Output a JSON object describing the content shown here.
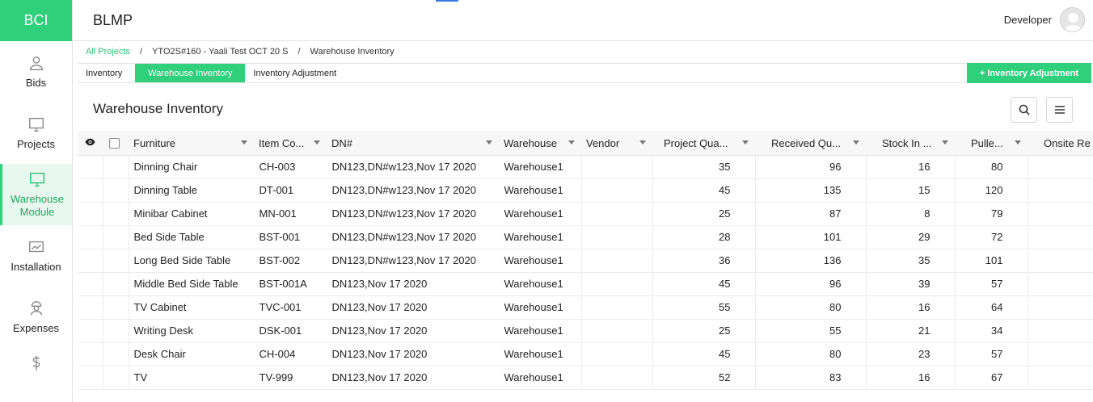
{
  "app": {
    "logo": "BCI",
    "title": "BLMP",
    "user": "Developer"
  },
  "sidebar": {
    "items": [
      {
        "label": "Bids",
        "icon": "person-icon"
      },
      {
        "label": "Projects",
        "icon": "monitor-icon"
      },
      {
        "label": "Warehouse\nModule",
        "icon": "warehouse-icon",
        "active": true
      },
      {
        "label": "Installation",
        "icon": "chart-icon"
      },
      {
        "label": "Expenses",
        "icon": "worker-icon"
      },
      {
        "label": "",
        "icon": "dollar-icon"
      }
    ]
  },
  "breadcrumb": {
    "root": "All Projects",
    "project": "YTO2S#160 - Yaali Test OCT 20 S",
    "current": "Warehouse Inventory",
    "sep": "/"
  },
  "tabs": [
    "Inventory",
    "Warehouse Inventory",
    "Inventory Adjustment"
  ],
  "active_tab": "Warehouse Inventory",
  "adjust_button": "+ Inventory Adjustment",
  "panel": {
    "title": "Warehouse Inventory"
  },
  "table": {
    "columns": [
      "Furniture",
      "Item Co...",
      "DN#",
      "Warehouse",
      "Vendor",
      "Project Qua...",
      "Received Qu...",
      "Stock In ...",
      "Pulle...",
      "Onsite Re"
    ],
    "rows": [
      [
        "Dinning Chair",
        "CH-003",
        "DN123,DN#w123,Nov 17 2020",
        "Warehouse1",
        "",
        "35",
        "96",
        "16",
        "80",
        ""
      ],
      [
        "Dinning Table",
        "DT-001",
        "DN123,DN#w123,Nov 17 2020",
        "Warehouse1",
        "",
        "45",
        "135",
        "15",
        "120",
        ""
      ],
      [
        "Minibar Cabinet",
        "MN-001",
        "DN123,DN#w123,Nov 17 2020",
        "Warehouse1",
        "",
        "25",
        "87",
        "8",
        "79",
        ""
      ],
      [
        "Bed Side Table",
        "BST-001",
        "DN123,DN#w123,Nov 17 2020",
        "Warehouse1",
        "",
        "28",
        "101",
        "29",
        "72",
        ""
      ],
      [
        "Long Bed Side Table",
        "BST-002",
        "DN123,DN#w123,Nov 17 2020",
        "Warehouse1",
        "",
        "36",
        "136",
        "35",
        "101",
        ""
      ],
      [
        "Middle Bed Side Table",
        "BST-001A",
        "DN123,Nov 17 2020",
        "Warehouse1",
        "",
        "45",
        "96",
        "39",
        "57",
        ""
      ],
      [
        "TV Cabinet",
        "TVC-001",
        "DN123,Nov 17 2020",
        "Warehouse1",
        "",
        "55",
        "80",
        "16",
        "64",
        ""
      ],
      [
        "Writing Desk",
        "DSK-001",
        "DN123,Nov 17 2020",
        "Warehouse1",
        "",
        "25",
        "55",
        "21",
        "34",
        ""
      ],
      [
        "Desk Chair",
        "CH-004",
        "DN123,Nov 17 2020",
        "Warehouse1",
        "",
        "45",
        "80",
        "23",
        "57",
        ""
      ],
      [
        "TV",
        "TV-999",
        "DN123,Nov 17 2020",
        "Warehouse1",
        "",
        "52",
        "83",
        "16",
        "67",
        ""
      ]
    ]
  },
  "colors": {
    "accent": "#2fcf7b",
    "link": "#2fbf74"
  }
}
